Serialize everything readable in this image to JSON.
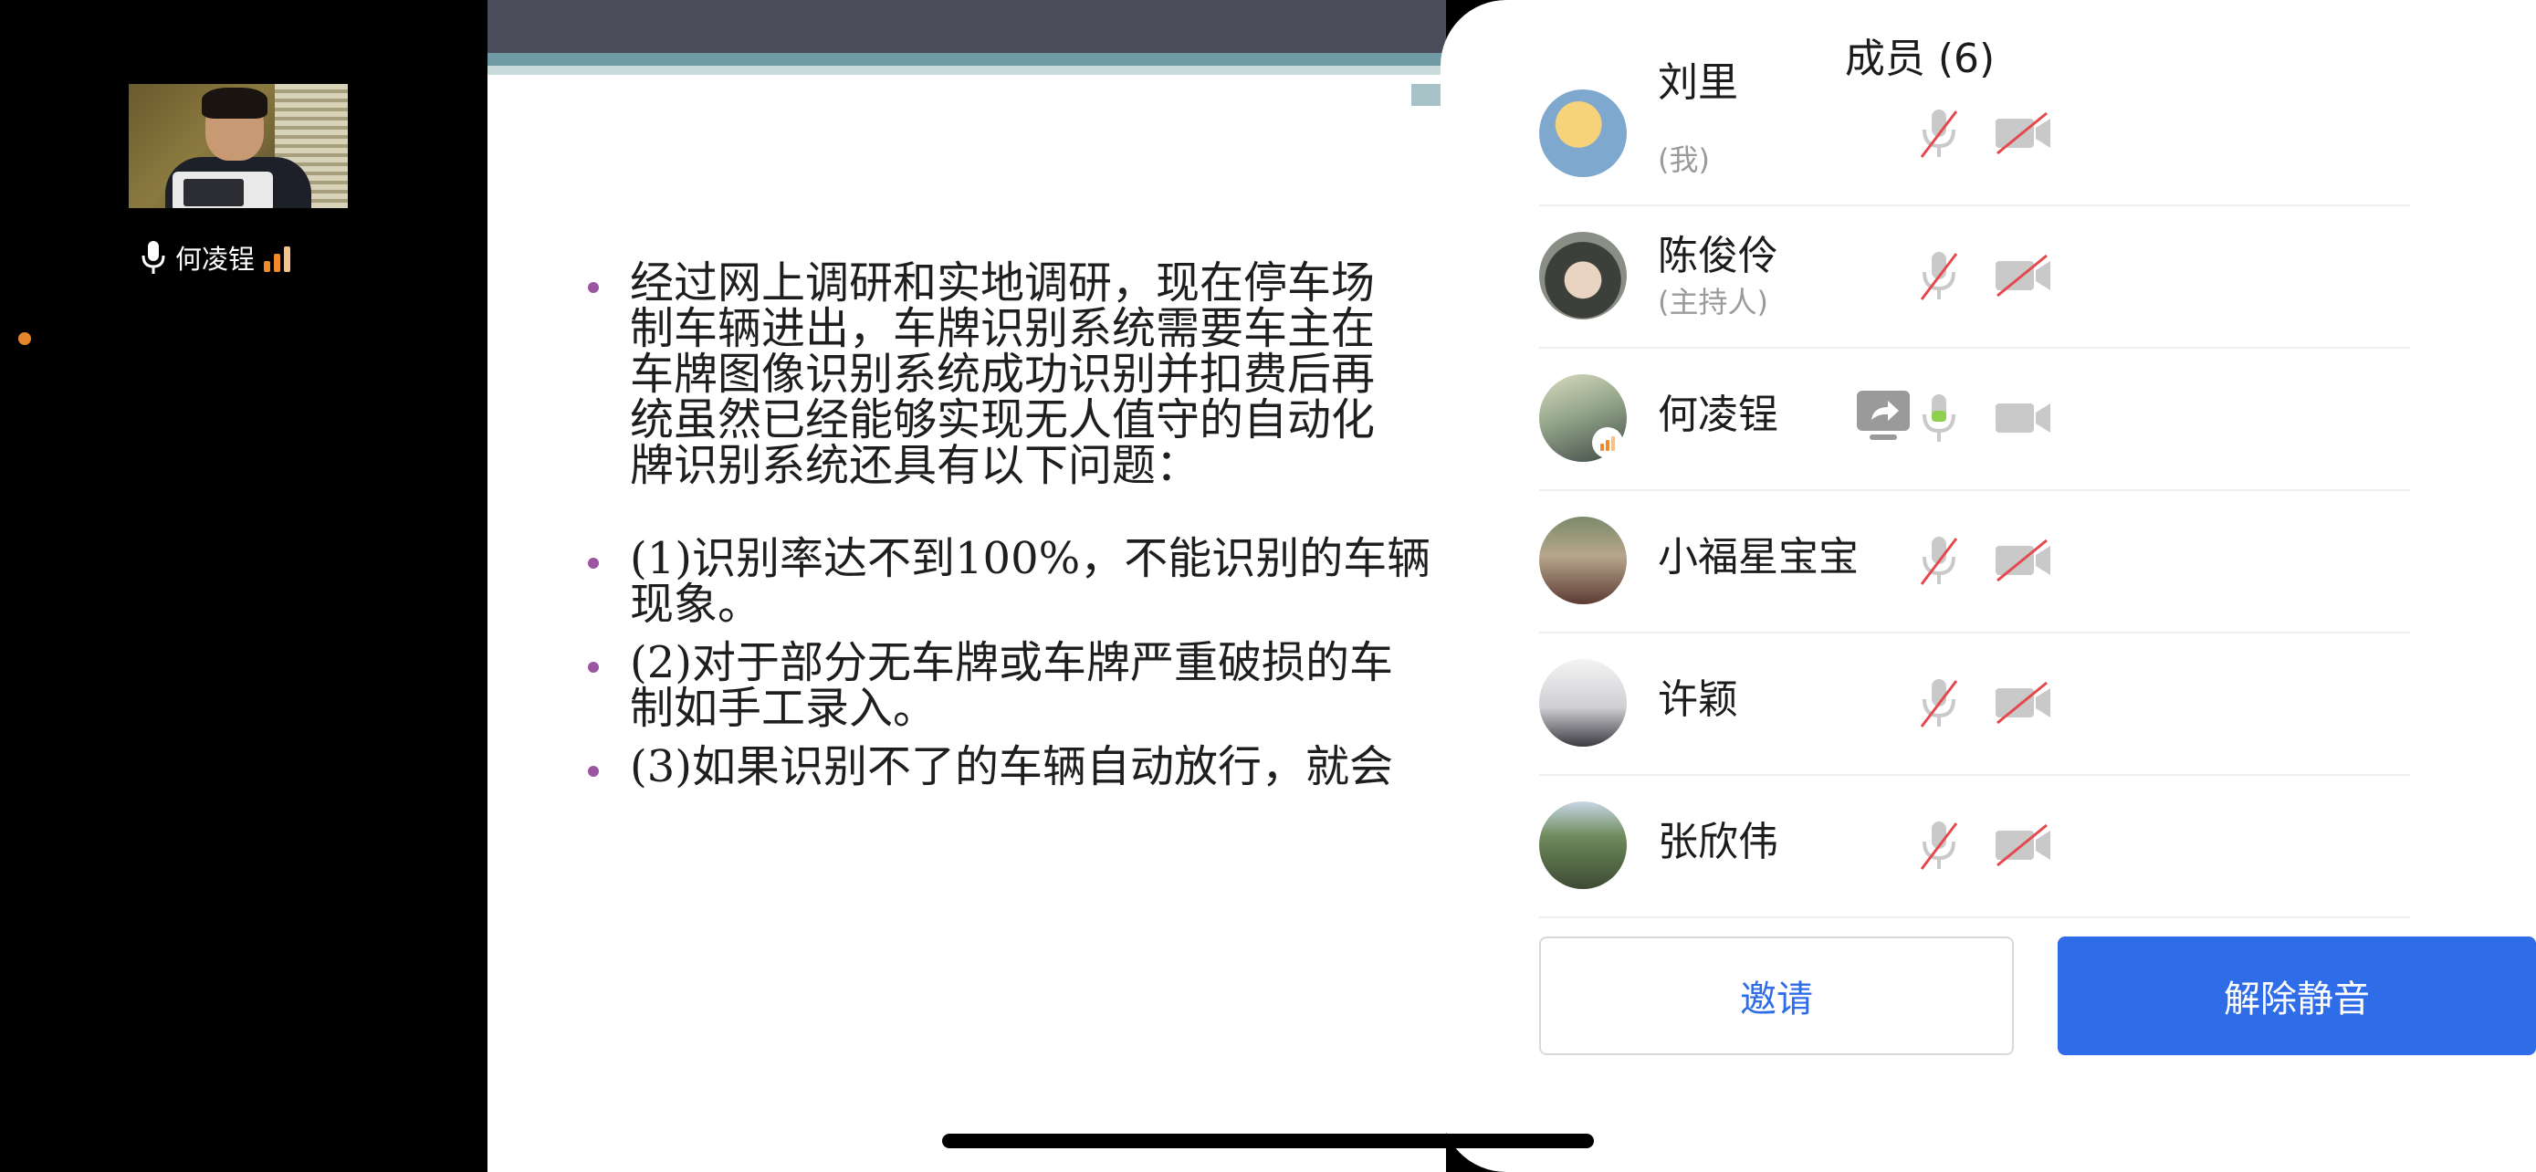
{
  "local_video": {
    "participant_name": "何凌锃"
  },
  "slide": {
    "bullets": [
      [
        "经过网上调研和实地调研，现在停车场",
        "制车辆进出，车牌识别系统需要车主在",
        "车牌图像识别系统成功识别并扣费后再",
        "统虽然已经能够实现无人值守的自动化",
        "牌识别系统还具有以下问题："
      ],
      [
        "(1)识别率达不到100%，不能识别的车辆",
        "现象。"
      ],
      [
        "(2)对于部分无车牌或车牌严重破损的车",
        "制如手工录入。"
      ],
      [
        "(3)如果识别不了的车辆自动放行，就会"
      ]
    ]
  },
  "members_panel": {
    "title": "成员 (6)",
    "members": [
      {
        "name": "刘里",
        "role": "(我)",
        "mic_muted": true,
        "video_off": true
      },
      {
        "name": "陈俊伶",
        "role": "(主持人)",
        "mic_muted": true,
        "video_off": true
      },
      {
        "name": "何凌锃",
        "role": "",
        "mic_muted": false,
        "video_off": true,
        "sharing_screen": true
      },
      {
        "name": "小福星宝宝",
        "role": "",
        "mic_muted": true,
        "video_off": true
      },
      {
        "name": "许颖",
        "role": "",
        "mic_muted": true,
        "video_off": true
      },
      {
        "name": "张欣伟",
        "role": "",
        "mic_muted": true,
        "video_off": true
      }
    ],
    "invite_label": "邀请",
    "unmute_label": "解除静音"
  },
  "colors": {
    "accent_blue": "#2f6ce8",
    "bullet_purple": "#9a55a3",
    "signal_orange": "#f08a2c",
    "muted_red": "#e5484d",
    "active_green": "#8fd14f"
  },
  "icons": [
    "microphone-icon",
    "signal-strength-icon",
    "microphone-muted-icon",
    "video-off-icon",
    "share-screen-icon",
    "video-camera-icon"
  ]
}
